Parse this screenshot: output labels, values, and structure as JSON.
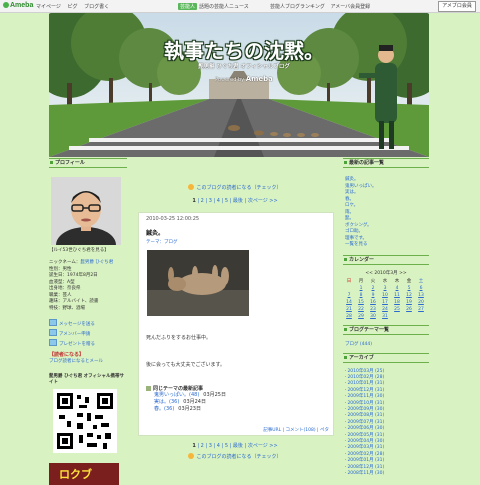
{
  "topbar": {
    "logo": "Ameba",
    "links": [
      "マイページ",
      "ピグ",
      "ブログ書く"
    ],
    "mid_badge": "芸能人",
    "mid_text": "話題の芸能人ニュース",
    "right_links": [
      "芸能人ブログランキング",
      "アメーバ会員登録"
    ],
    "register_button": "アメブロ会員"
  },
  "banner": {
    "title": "執事たちの沈黙。",
    "subtitle": "髭男爵 ひぐち君 オフィシャルブログ",
    "powered_label": "Powered by",
    "powered_brand": "Ameba"
  },
  "left": {
    "profile_heading": "プロフィール",
    "profile_link": "【ルイ53世ひぐち君を見る】",
    "info": [
      {
        "label": "ニックネーム：",
        "value": "髭男爵 ひぐち君"
      },
      {
        "label": "性別：",
        "value": "男性"
      },
      {
        "label": "誕生日：",
        "value": "1974年8月2日"
      },
      {
        "label": "血液型：",
        "value": "A型"
      },
      {
        "label": "出身地：",
        "value": "奈良県"
      },
      {
        "label": "職業：",
        "value": "芸人"
      },
      {
        "label": "趣味：",
        "value": "アルバイト、読書"
      },
      {
        "label": "特技：",
        "value": "野球、酒場"
      }
    ],
    "icon_links": [
      "メッセージを送る",
      "アメンバー申請",
      "プレゼントを贈る"
    ],
    "reader_heading": "【読者になる】",
    "reader_sub": "ブログ読者になるとメール",
    "qr_label": "髭男爵 ひぐち君 オフィシャル携帯サイト",
    "ad_text": "ロクブ"
  },
  "center": {
    "reader_link": "このブログの読者になる（チェック）",
    "pager": {
      "pages": [
        "1",
        "2",
        "3",
        "4",
        "5"
      ],
      "last": "最後",
      "next": "次ページ >>"
    },
    "entry": {
      "date": "2010-03-25 12:00:25",
      "title": "鍼灸。",
      "theme": "テーマ：ブログ",
      "text1": "死んだふりをするお仕事中。",
      "text2": "後に会っても大丈夫でございます。",
      "latest_heading": "同じテーマの最新記事",
      "latest": [
        {
          "title": "鬼男いっぱい。(48)",
          "date": "03月25日"
        },
        {
          "title": "実は。(36)",
          "date": "03月24日"
        },
        {
          "title": "春。(36)",
          "date": "03月23日"
        }
      ],
      "footer": "記事URL | コメント(108) | ペタ"
    }
  },
  "right": {
    "recent_heading": "最新の記事一覧",
    "recent": [
      "鍼灸。",
      "鬼男いっぱい。",
      "実は。",
      "春。",
      "ロケ。",
      "雨。",
      "髭。",
      "ボクシング。",
      "ゴロ助。",
      "理事です。"
    ],
    "recent_more": "一覧を見る",
    "calendar_heading": "カレンダー",
    "calendar": {
      "month_nav": "<< 2010年3月 >>",
      "dow": [
        "日",
        "月",
        "火",
        "水",
        "木",
        "金",
        "土"
      ],
      "weeks": [
        [
          "",
          "1",
          "2",
          "3",
          "4",
          "5",
          "6"
        ],
        [
          "7",
          "8",
          "9",
          "10",
          "11",
          "12",
          "13"
        ],
        [
          "14",
          "15",
          "16",
          "17",
          "18",
          "19",
          "20"
        ],
        [
          "21",
          "22",
          "23",
          "24",
          "25",
          "26",
          "27"
        ],
        [
          "28",
          "29",
          "30",
          "31",
          "",
          "",
          ""
        ]
      ]
    },
    "theme_heading": "ブログテーマ一覧",
    "theme_item": "ブログ (444)",
    "archive_heading": "アーカイブ",
    "archive": [
      "2010年03月 (25)",
      "2010年02月 (28)",
      "2010年01月 (31)",
      "2009年12月 (31)",
      "2009年11月 (30)",
      "2009年10月 (31)",
      "2009年09月 (30)",
      "2009年08月 (31)",
      "2009年07月 (31)",
      "2009年06月 (30)",
      "2009年05月 (31)",
      "2009年04月 (30)",
      "2009年03月 (31)",
      "2009年02月 (28)",
      "2009年01月 (31)",
      "2008年12月 (31)",
      "2008年11月 (30)"
    ]
  }
}
